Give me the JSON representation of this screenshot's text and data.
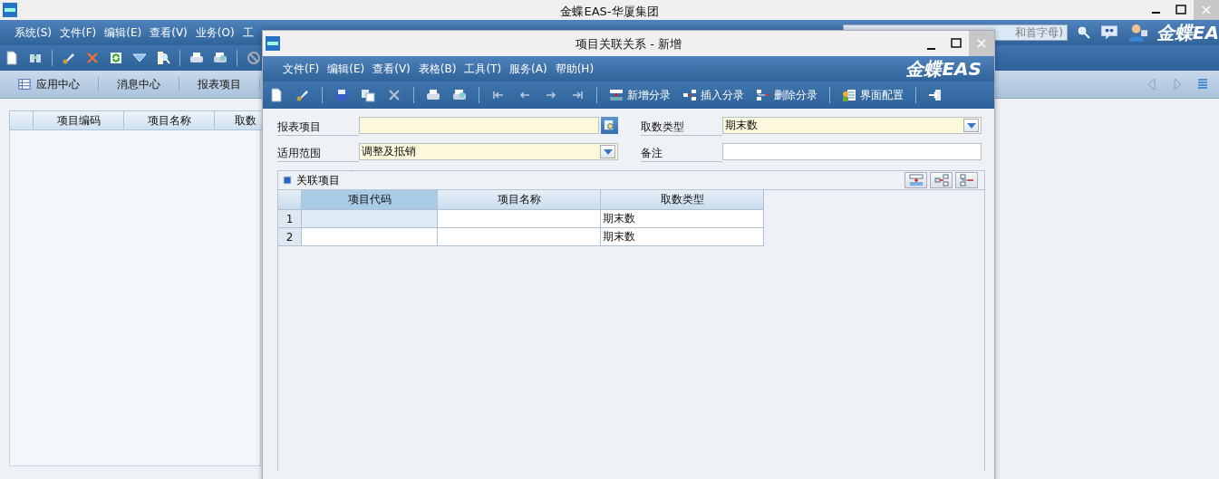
{
  "main_window": {
    "title": "金蝶EAS-华厦集团",
    "menus": [
      "系统(S)",
      "文件(F)",
      "编辑(E)",
      "查看(V)",
      "业务(O)",
      "工"
    ],
    "search": {
      "placeholder": "和首字母)"
    },
    "logo": "金蝶EA",
    "tabs": [
      "应用中心",
      "消息中心",
      "报表项目"
    ],
    "table": {
      "columns": [
        "项目编码",
        "项目名称",
        "取数"
      ]
    }
  },
  "dialog": {
    "title": "项目关联关系 - 新增",
    "menus": [
      "文件(F)",
      "编辑(E)",
      "查看(V)",
      "表格(B)",
      "工具(T)",
      "服务(A)",
      "帮助(H)"
    ],
    "logo": "金蝶EAS",
    "toolbar_buttons": [
      "新增分录",
      "插入分录",
      "删除分录",
      "界面配置"
    ],
    "fields": [
      {
        "label": "报表项目",
        "kind": "lookup"
      },
      {
        "label": "取数类型",
        "kind": "select",
        "value": "期末数"
      },
      {
        "label": "适用范围",
        "kind": "select",
        "value": "调整及抵销"
      },
      {
        "label": "备注",
        "kind": "text"
      }
    ],
    "tab": {
      "label": "关联项目"
    },
    "grid": {
      "columns": [
        "项目代码",
        "项目名称",
        "取数类型"
      ],
      "rows": [
        {
          "number": "1",
          "fetch_type": "期末数",
          "selected": true
        },
        {
          "number": "2",
          "fetch_type": "期末数",
          "selected": false
        }
      ]
    }
  }
}
